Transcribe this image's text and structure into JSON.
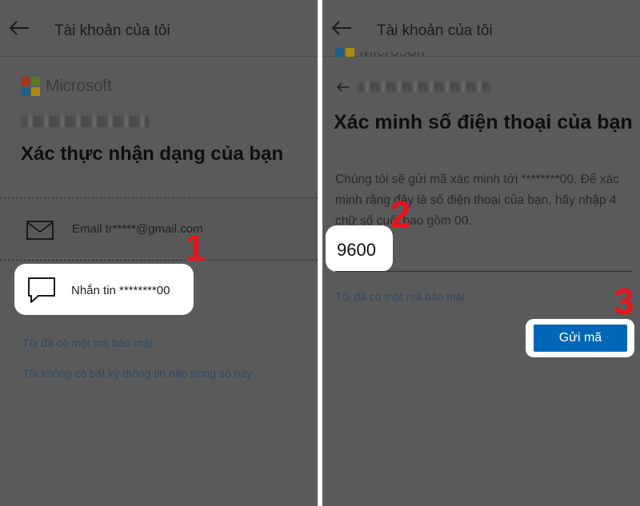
{
  "left": {
    "header_title": "Tài khoản của tôi",
    "brand": "Microsoft",
    "heading": "Xác thực nhận dạng của bạn",
    "options": [
      {
        "label": "Email tr*****@gmail.com",
        "icon": "envelope-icon"
      },
      {
        "label": "Nhắn tin ********00",
        "icon": "message-icon"
      }
    ],
    "links": [
      "Tôi đã có một mã bảo mật",
      "Tôi không có bất kỳ thông tin nào trong số này"
    ],
    "step_marker": "1"
  },
  "right": {
    "header_title": "Tài khoản của tôi",
    "brand": "Microsoft",
    "heading": "Xác minh số điện thoại của bạn",
    "description": "Chúng tôi sẽ gửi mã xác minh tới ********00. Để xác minh rằng đây là số điện thoại của bạn, hãy nhập 4 chữ số cuối bao gồm 00.",
    "code_value": "9600",
    "link": "Tôi đã có một mã bảo mật",
    "send_button": "Gửi mã",
    "step_markers": [
      "2",
      "3"
    ]
  },
  "colors": {
    "overlay": "#5a5a5a",
    "button": "#0067b8",
    "step_marker": "#e8141c",
    "link": "#2b4a66"
  }
}
